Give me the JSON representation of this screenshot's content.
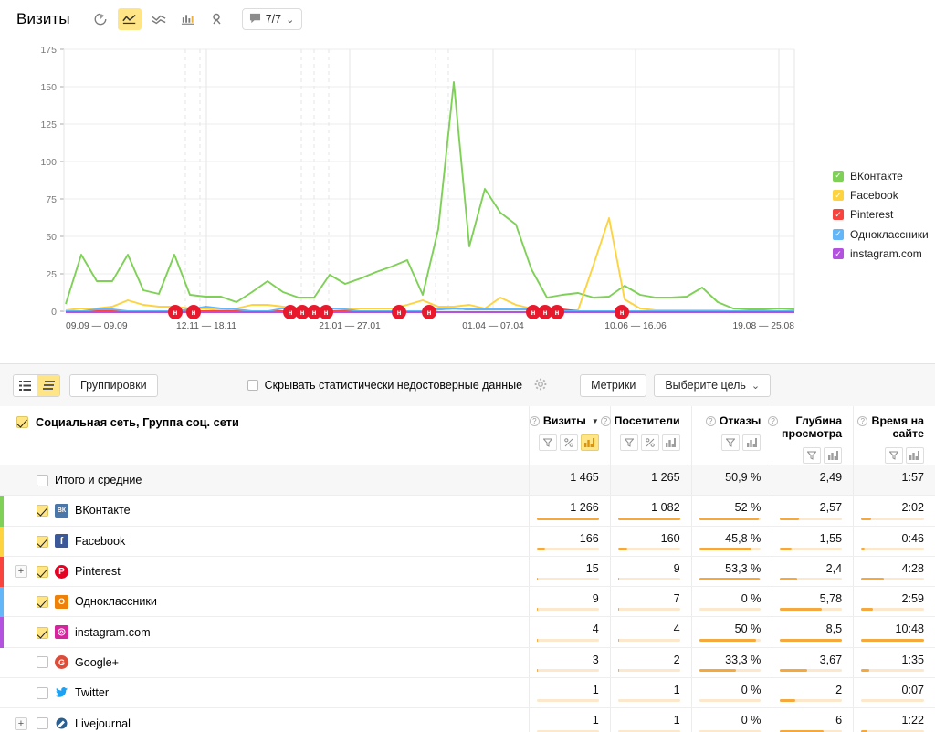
{
  "header": {
    "title": "Визиты",
    "icons": [
      {
        "name": "pie-chart-icon",
        "active": false
      },
      {
        "name": "line-chart-icon",
        "active": true
      },
      {
        "name": "area-chart-icon",
        "active": false
      },
      {
        "name": "bar-chart-icon",
        "active": false
      },
      {
        "name": "map-pin-icon",
        "active": false
      }
    ],
    "chat_button": {
      "label": "7/7",
      "icon": "speech-bubble-icon",
      "caret": "⌄"
    }
  },
  "chart_data": {
    "type": "line",
    "title": "Визиты",
    "xlabel": "",
    "ylabel": "",
    "ylim": [
      0,
      175
    ],
    "yticks": [
      0,
      25,
      50,
      75,
      100,
      125,
      150,
      175
    ],
    "grid": true,
    "legend_position": "right",
    "xtick_labels": [
      "09.09 — 09.09",
      "12.11 — 18.11",
      "21.01 — 27.01",
      "01.04 — 07.04",
      "10.06 — 16.06",
      "19.08 — 25.08"
    ],
    "series": [
      {
        "name": "ВКонтакте",
        "color": "#7ed156",
        "values": [
          5,
          38,
          20,
          20,
          38,
          14,
          12,
          38,
          11,
          10,
          10,
          6,
          13,
          20,
          13,
          9,
          9,
          24,
          18,
          22,
          26,
          30,
          34,
          11,
          55,
          153,
          43,
          82,
          66,
          58,
          28,
          9,
          11,
          12,
          9,
          10,
          17,
          11,
          9,
          9,
          10,
          16,
          6,
          2,
          1,
          1,
          2,
          1
        ]
      },
      {
        "name": "Facebook",
        "color": "#fdd33f",
        "values": [
          1,
          2,
          2,
          3,
          7,
          4,
          3,
          3,
          2,
          2,
          1,
          2,
          4,
          4,
          3,
          2,
          2,
          2,
          2,
          2,
          2,
          2,
          4,
          7,
          3,
          3,
          4,
          2,
          9,
          4,
          2,
          1,
          1,
          1,
          31,
          62,
          8,
          2,
          1,
          1,
          1,
          1,
          1,
          0,
          0,
          0,
          0,
          0
        ]
      },
      {
        "name": "Pinterest",
        "color": "#f8443c",
        "values": [
          0,
          0,
          0,
          0,
          0,
          0,
          0,
          0,
          0,
          0,
          0,
          0,
          0,
          0,
          0,
          0,
          0,
          0,
          0,
          0,
          0,
          0,
          0,
          0,
          1,
          2,
          1,
          1,
          2,
          1,
          1,
          1,
          1,
          0,
          0,
          0,
          0,
          0,
          0,
          0,
          0,
          0,
          0,
          0,
          0,
          0,
          0,
          0
        ]
      },
      {
        "name": "Одноклассники",
        "color": "#63b6f7",
        "values": [
          0,
          0,
          1,
          1,
          0,
          0,
          0,
          0,
          1,
          3,
          2,
          1,
          0,
          0,
          2,
          2,
          1,
          2,
          1,
          0,
          0,
          0,
          0,
          0,
          1,
          2,
          1,
          1,
          1,
          1,
          1,
          0,
          0,
          0,
          0,
          0,
          0,
          0,
          0,
          0,
          0,
          0,
          0,
          0,
          0,
          0,
          0,
          0
        ]
      },
      {
        "name": "instagram.com",
        "color": "#b452e0",
        "values": [
          0,
          0,
          0,
          0,
          0,
          0,
          0,
          0,
          0,
          0,
          0,
          0,
          0,
          0,
          0,
          0,
          0,
          0,
          0,
          0,
          0,
          0,
          0,
          0,
          0,
          0,
          0,
          0,
          0,
          0,
          0,
          0,
          0,
          0,
          0,
          0,
          0,
          0,
          0,
          0,
          0,
          0,
          0,
          0,
          0,
          0,
          0,
          0
        ]
      }
    ],
    "event_markers_label": "н"
  },
  "table_toolbar": {
    "view_list_icon": "list-view-icon",
    "view_tree_icon": "tree-view-icon",
    "groupings_label": "Группировки",
    "hide_unreliable_label": "Скрывать статистически недостоверные данные",
    "settings_icon": "gear-icon",
    "metrics_label": "Метрики",
    "goal_label": "Выберите цель",
    "goal_caret": "⌄"
  },
  "table": {
    "dimension_header": "Социальная сеть, Группа соц. сети",
    "metrics": [
      {
        "label": "Визиты",
        "sorted": true,
        "tools": [
          "filter-icon",
          "percent-icon",
          "bars-icon"
        ],
        "active_tool": "bars-icon"
      },
      {
        "label": "Посетители",
        "sorted": false,
        "tools": [
          "filter-icon",
          "percent-icon",
          "bars-icon"
        ],
        "active_tool": ""
      },
      {
        "label": "Отказы",
        "sorted": false,
        "tools": [
          "filter-icon",
          "bars-icon"
        ],
        "active_tool": ""
      },
      {
        "label": "Глубина просмотра",
        "sorted": false,
        "tools": [
          "filter-icon",
          "bars-icon"
        ],
        "active_tool": ""
      },
      {
        "label": "Время на сайте",
        "sorted": false,
        "tools": [
          "filter-icon",
          "bars-icon"
        ],
        "active_tool": ""
      }
    ],
    "rows": [
      {
        "name": "Итого и средние",
        "checked": false,
        "total": true,
        "color": "",
        "expandable": false,
        "icon": "",
        "icon_bg": "",
        "visits": "1 465",
        "visitors": "1 265",
        "bounce": "50,9 %",
        "depth": "2,49",
        "time": "1:57",
        "bars": [
          0,
          0,
          0,
          0,
          0
        ]
      },
      {
        "name": "ВКонтакте",
        "checked": true,
        "total": false,
        "color": "#7ed156",
        "expandable": false,
        "icon": "vk-icon",
        "icon_bg": "#4a76a8",
        "visits": "1 266",
        "visitors": "1 082",
        "bounce": "52 %",
        "depth": "2,57",
        "time": "2:02",
        "bars": [
          100,
          100,
          96,
          30,
          16
        ]
      },
      {
        "name": "Facebook",
        "checked": true,
        "total": false,
        "color": "#fdd33f",
        "expandable": false,
        "icon": "facebook-icon",
        "icon_bg": "#3b5998",
        "visits": "166",
        "visitors": "160",
        "bounce": "45,8 %",
        "depth": "1,55",
        "time": "0:46",
        "bars": [
          13,
          15,
          85,
          18,
          6
        ]
      },
      {
        "name": "Pinterest",
        "checked": true,
        "total": false,
        "color": "#f8443c",
        "expandable": true,
        "icon": "pinterest-icon",
        "icon_bg": "#e60023",
        "visits": "15",
        "visitors": "9",
        "bounce": "53,3 %",
        "depth": "2,4",
        "time": "4:28",
        "bars": [
          2,
          1,
          98,
          28,
          36
        ]
      },
      {
        "name": "Одноклассники",
        "checked": true,
        "total": false,
        "color": "#63b6f7",
        "expandable": false,
        "icon": "odnoklassniki-icon",
        "icon_bg": "#ee8208",
        "visits": "9",
        "visitors": "7",
        "bounce": "0 %",
        "depth": "5,78",
        "time": "2:59",
        "bars": [
          1,
          1,
          0,
          68,
          18
        ]
      },
      {
        "name": "instagram.com",
        "checked": true,
        "total": false,
        "color": "#b452e0",
        "expandable": false,
        "icon": "instagram-icon",
        "icon_bg": "#d6249f",
        "visits": "4",
        "visitors": "4",
        "bounce": "50 %",
        "depth": "8,5",
        "time": "10:48",
        "bars": [
          1,
          1,
          92,
          100,
          100
        ]
      },
      {
        "name": "Google+",
        "checked": false,
        "total": false,
        "color": "",
        "expandable": false,
        "icon": "googleplus-icon",
        "icon_bg": "#dd4b39",
        "visits": "3",
        "visitors": "2",
        "bounce": "33,3 %",
        "depth": "3,67",
        "time": "1:35",
        "bars": [
          1,
          1,
          60,
          43,
          13
        ]
      },
      {
        "name": "Twitter",
        "checked": false,
        "total": false,
        "color": "",
        "expandable": false,
        "icon": "twitter-icon",
        "icon_bg": "#1da1f2",
        "visits": "1",
        "visitors": "1",
        "bounce": "0 %",
        "depth": "2",
        "time": "0:07",
        "bars": [
          0,
          0,
          0,
          24,
          0
        ]
      },
      {
        "name": "Livejournal",
        "checked": false,
        "total": false,
        "color": "",
        "expandable": true,
        "icon": "livejournal-icon",
        "icon_bg": "#004359",
        "visits": "1",
        "visitors": "1",
        "bounce": "0 %",
        "depth": "6",
        "time": "1:22",
        "bars": [
          0,
          0,
          0,
          70,
          10
        ]
      }
    ]
  }
}
